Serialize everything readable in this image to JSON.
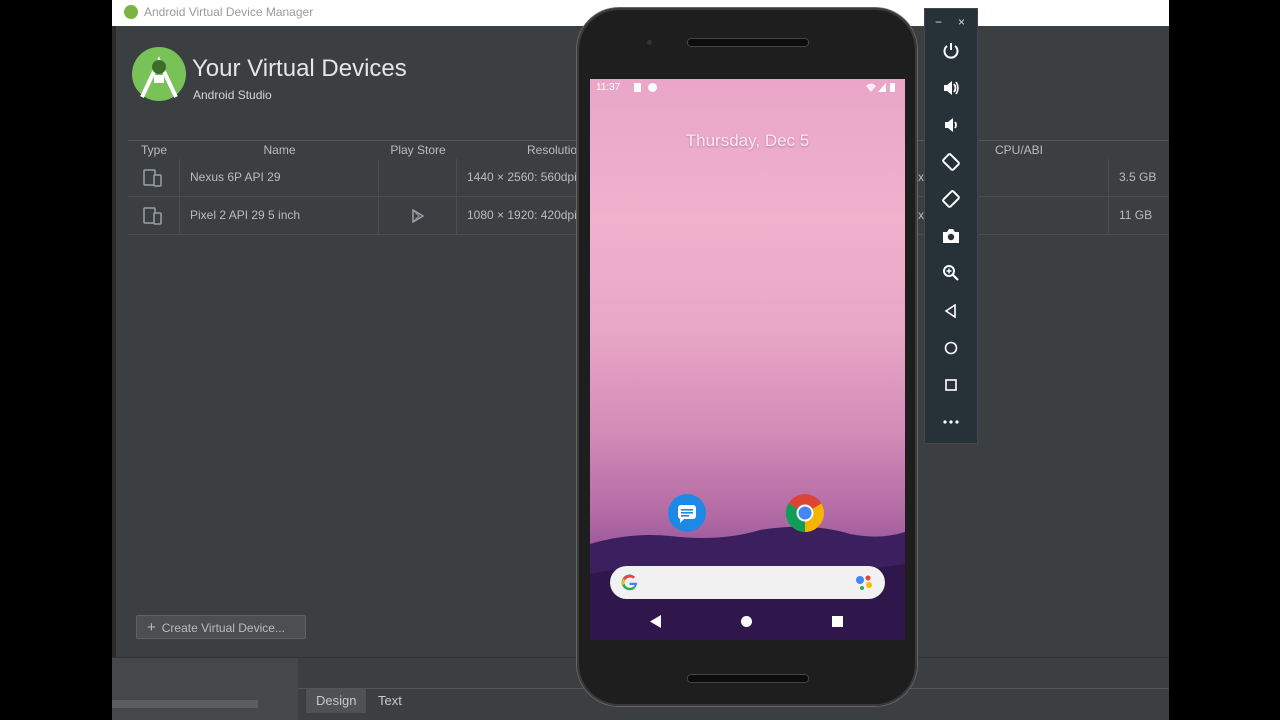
{
  "window": {
    "title": "Android Virtual Device Manager"
  },
  "header": {
    "title": "Your Virtual Devices",
    "subtitle": "Android Studio"
  },
  "table": {
    "columns": {
      "type": "Type",
      "name": "Name",
      "play_store": "Play Store",
      "resolution": "Resolutio",
      "cpu": "CPU/ABI"
    },
    "rows": [
      {
        "name": "Nexus 6P API 29",
        "resolution": "1440 × 2560: 560dpi",
        "api_fragment": "x",
        "size": "3.5 GB"
      },
      {
        "name": "Pixel 2 API 29 5 inch",
        "resolution": "1080 × 1920: 420dpi",
        "api_fragment": "x",
        "size": "11 GB"
      }
    ]
  },
  "create_button": {
    "label": "Create Virtual Device..."
  },
  "bottom_tabs": {
    "design": "Design",
    "text": "Text"
  },
  "phone": {
    "time": "11:37",
    "date": "Thursday, Dec 5"
  },
  "emulator_toolbar": {
    "minimize": "−",
    "close": "×"
  },
  "colors": {
    "ide_bg": "#3c3f41",
    "android_green": "#78c257",
    "toolbar_bg": "#263238"
  }
}
